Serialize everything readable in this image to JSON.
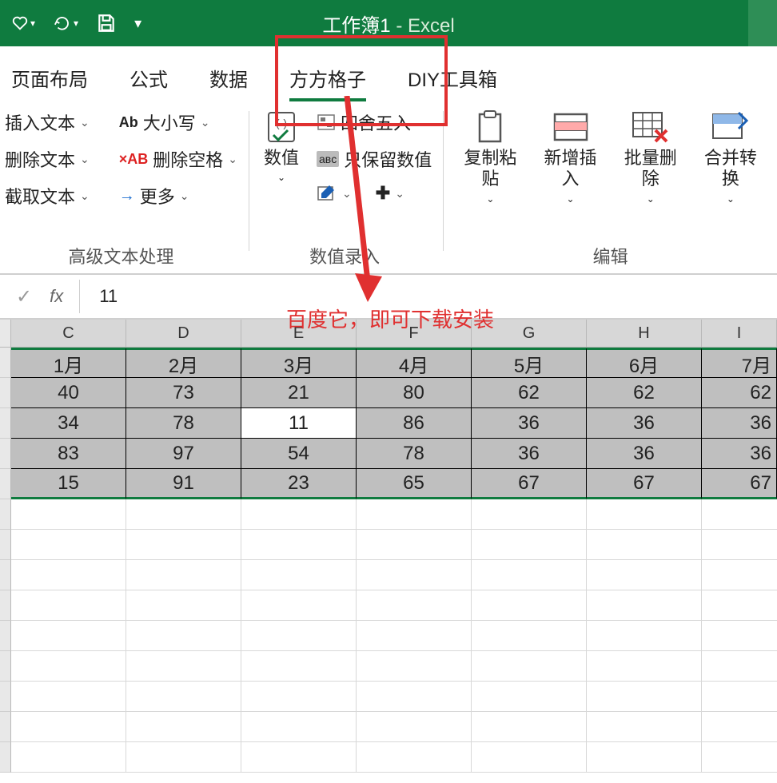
{
  "titlebar": {
    "title_main": "工作簿1",
    "title_sep": " - ",
    "title_app": "Excel"
  },
  "tabs": {
    "items": [
      "页面布局",
      "公式",
      "数据",
      "方方格子",
      "DIY工具箱"
    ],
    "active_index": 3
  },
  "ribbon": {
    "group1": {
      "col1": [
        "插入文本",
        "删除文本",
        "截取文本"
      ],
      "col2_case": "大小写",
      "col2_case_badge": "Ab",
      "col2_del": "删除空格",
      "col2_del_badge": "×AB",
      "col2_more": "更多",
      "label": "高级文本处理"
    },
    "group2": {
      "btn_num": "数值",
      "round": "四舍五入",
      "keeponly": "只保留数值",
      "label": "数值录入"
    },
    "group3": {
      "copy": "复制粘贴",
      "insert": "新增插入",
      "delete": "批量删除",
      "merge": "合并转换",
      "label": "编辑"
    }
  },
  "formula_bar": {
    "fx": "fx",
    "value": "11"
  },
  "annotation": "百度它，即可下载安装",
  "columns": [
    "C",
    "D",
    "E",
    "F",
    "G",
    "H",
    "I"
  ],
  "data_rows": [
    [
      "1月",
      "2月",
      "3月",
      "4月",
      "5月",
      "6月",
      "7月"
    ],
    [
      "40",
      "73",
      "21",
      "80",
      "62",
      "62",
      "62"
    ],
    [
      "34",
      "78",
      "11",
      "86",
      "36",
      "36",
      "36"
    ],
    [
      "83",
      "97",
      "54",
      "78",
      "36",
      "36",
      "36"
    ],
    [
      "15",
      "91",
      "23",
      "65",
      "67",
      "67",
      "67"
    ]
  ],
  "active_cell": {
    "row": 2,
    "col": 2
  },
  "empty_row_count": 9
}
